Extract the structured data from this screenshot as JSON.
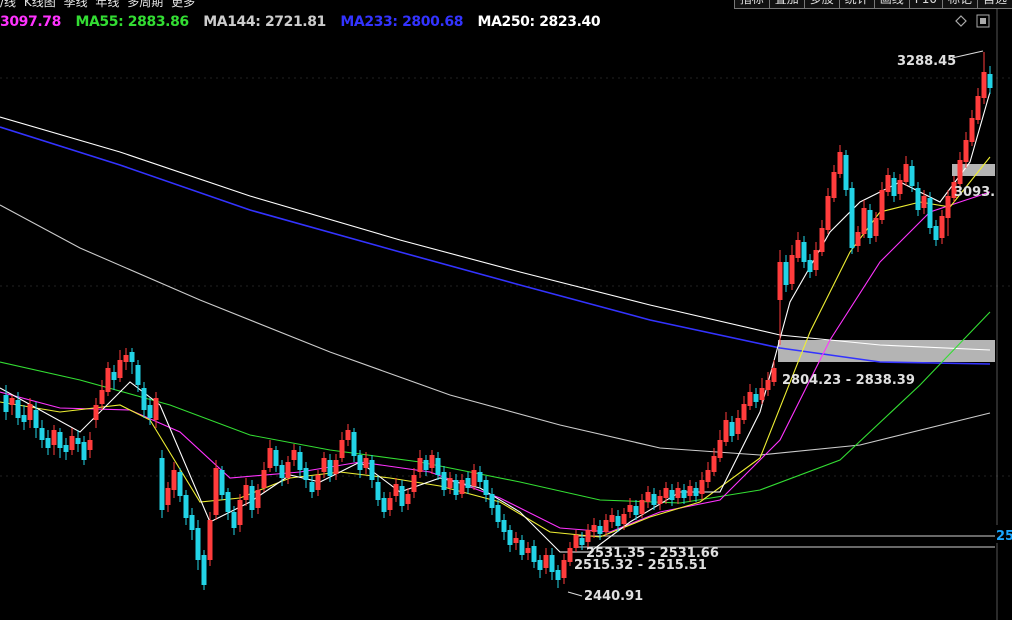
{
  "toolbar": {
    "left_items": [
      "/线",
      "K线图",
      "季线",
      "年线",
      "多周期",
      "更多"
    ],
    "right_buttons": [
      "指标",
      "叠加",
      "多股",
      "统计",
      "画线",
      "F10",
      "标记",
      "自选"
    ]
  },
  "ma_legend": [
    {
      "name": "MA",
      "value": "3097.78",
      "color": "#ff33ff"
    },
    {
      "name": "MA55",
      "value": "2883.86",
      "color": "#33dd33"
    },
    {
      "name": "MA144",
      "value": "2721.81",
      "color": "#cccccc"
    },
    {
      "name": "MA233",
      "value": "2800.68",
      "color": "#3333ff"
    },
    {
      "name": "MA250",
      "value": "2823.40",
      "color": "#ffffff"
    }
  ],
  "icons": [
    "diamond-icon",
    "restore-window-icon"
  ],
  "annotations": {
    "high": "3288.45",
    "zone_right": "3093.",
    "zone_mid": "2804.23 - 2838.39",
    "zone_low_1": "2531.35 - 2531.66",
    "zone_low_2": "2515.32 - 2515.51",
    "low": "2440.91",
    "price_tag": "25"
  },
  "colors": {
    "up": "#ff3c3c",
    "down": "#22d3e6",
    "ma5": "#ffffff",
    "ma10": "#eeee33",
    "ma20": "#ff33ff",
    "ma55": "#33dd33",
    "ma144": "#cccccc",
    "ma233": "#3333ff",
    "ma250": "#ffffff",
    "zone": "#b4b4b4",
    "grid": "#3a3a3a"
  }
}
